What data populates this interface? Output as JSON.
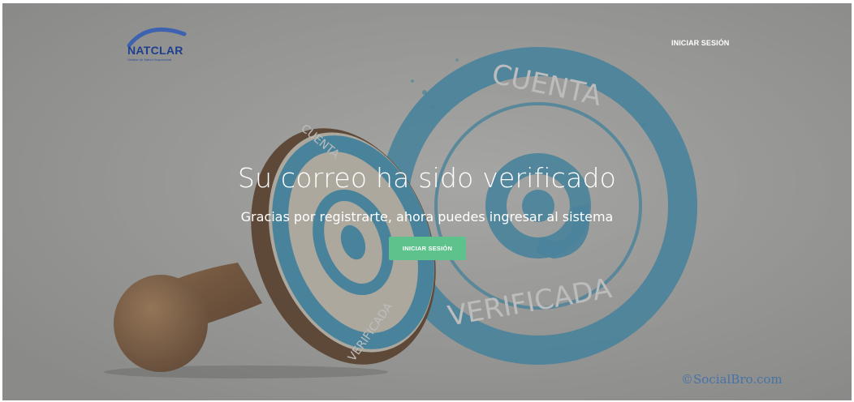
{
  "brand": {
    "name": "NATCLAR",
    "tagline": "Gestión de Salud Ocupacional"
  },
  "nav": {
    "login_label": "INICIAR SESIÓN"
  },
  "hero": {
    "headline": "Su correo ha sido verificado",
    "subheadline": "Gracias por registrarte, ahora puedes ingresar al sistema",
    "cta_label": "INICIAR SESIÓN",
    "stamp_text_top": "CUENTA",
    "stamp_text_bottom": "VERIFICADA",
    "stamp_symbol": "@",
    "small_stamp_text_top": "CUENTA",
    "small_stamp_text_bottom": "VERIFICADA",
    "watermark": "©SocialBro.com"
  },
  "colors": {
    "brand_blue": "#1e3f8f",
    "cta_green": "#5ec28d",
    "stamp_blue": "#3a9cc6",
    "handle_brown": "#8a5a32"
  }
}
